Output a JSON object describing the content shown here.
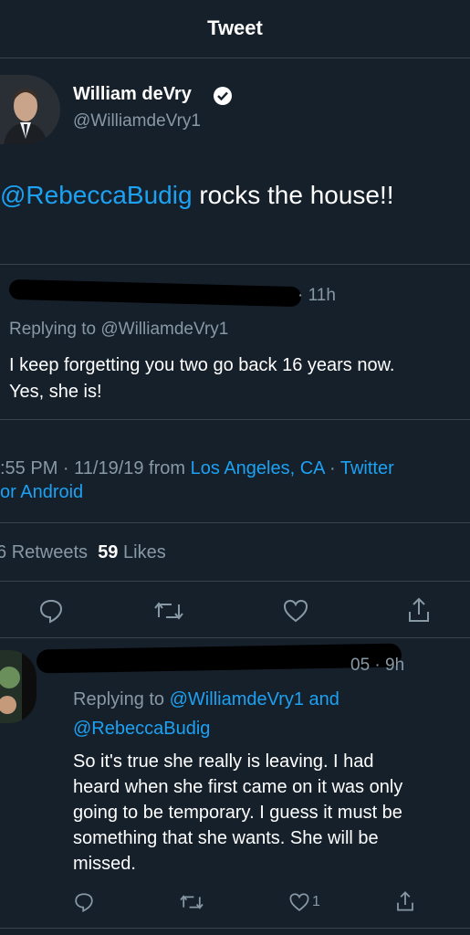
{
  "header": {
    "title": "Tweet"
  },
  "tweet": {
    "author_name": "William deVry",
    "handle": "@WilliamdeVry1",
    "text_mention": "@RebeccaBudig",
    "text_rest": " rocks the house!!",
    "time_meta": ":55 PM · 11/19/19 from ",
    "location": "Los Angeles, CA",
    "dot_sep": " · ",
    "client_1": "Twitter",
    "client_2": "or Android",
    "retweets_label": "Retweets",
    "retweets_partial": "6",
    "likes_count": "59",
    "likes_label": "Likes"
  },
  "quoted_reply": {
    "time": "· 11h",
    "replying_prefix": "Replying to ",
    "replying_handle": "@WilliamdeVry1",
    "text_line1": "I keep forgetting you two go back 16 years now.",
    "text_line2": "Yes, she is!"
  },
  "reply": {
    "time_fragment": "05 · 9h",
    "replying_prefix": "Replying to ",
    "replying_handle1": "@WilliamdeVry1",
    "replying_and": " and",
    "replying_handle2": "@RebeccaBudig",
    "text_lines": [
      "So it's true she really is leaving. I had",
      "heard when she first came on it was only",
      "going to be temporary. I guess it must be",
      "something that she wants. She will be",
      "missed."
    ],
    "like_count": "1"
  },
  "colors": {
    "bg": "#15202b",
    "accent": "#1da1f2",
    "muted": "#8899a6",
    "divider": "#38444d"
  },
  "icons": [
    "verified-icon",
    "reply-icon",
    "retweet-icon",
    "like-icon",
    "share-icon"
  ]
}
